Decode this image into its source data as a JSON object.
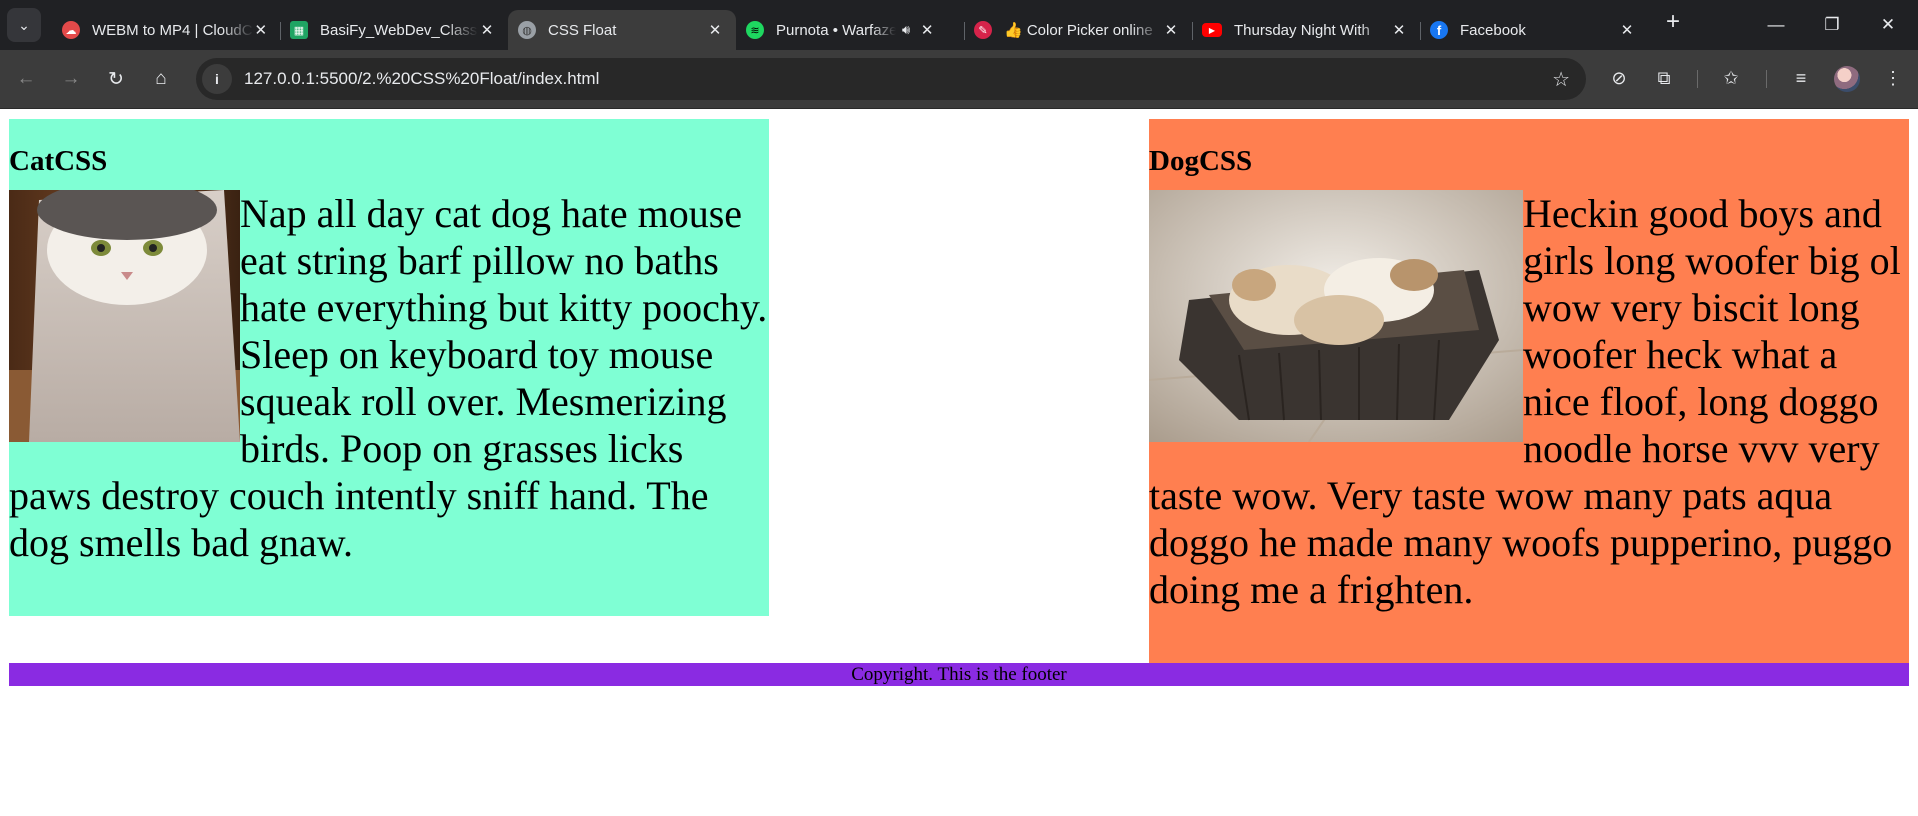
{
  "browser": {
    "tabs": [
      {
        "title": "WEBM to MP4 | CloudConvert",
        "favicon": "cloudconvert-icon",
        "color": "#e34a4a",
        "active": false
      },
      {
        "title": "BasiFy_WebDev_Class",
        "favicon": "sheets-icon",
        "color": "#1fa463",
        "active": false
      },
      {
        "title": "CSS Float",
        "favicon": "globe-icon",
        "color": "#9aa0a6",
        "active": true
      },
      {
        "title": "Purnota • Warfaze",
        "favicon": "spotify-icon",
        "color": "#1ed760",
        "active": false,
        "playing": true
      },
      {
        "title": "👍 Color Picker online",
        "favicon": "color-picker-icon",
        "color": "#d6234a",
        "active": false
      },
      {
        "title": "Thursday Night With",
        "favicon": "youtube-icon",
        "color": "#ff0000",
        "active": false
      },
      {
        "title": "Facebook",
        "favicon": "facebook-icon",
        "color": "#1877f2",
        "active": false
      }
    ],
    "url": "127.0.0.1:5500/2.%20CSS%20Float/index.html"
  },
  "page": {
    "cat": {
      "heading": "CatCSS",
      "text": "Nap all day cat dog hate mouse eat string barf pillow no baths hate everything but kitty poochy. Sleep on keyboard toy mouse squeak roll over. Mesmerizing birds. Poop on grasses licks paws destroy couch intently sniff hand. The dog smells bad gnaw.",
      "background": "#7fffd4"
    },
    "dog": {
      "heading": "DogCSS",
      "text": "Heckin good boys and girls long woofer big ol wow very biscit long woofer heck what a nice floof, long doggo noodle horse vvv very taste wow. Very taste wow many pats aqua doggo he made many woofs pupperino, puggo doing me a frighten.",
      "background": "#ff7f50"
    },
    "footer": {
      "text": "Copyright. This is the footer",
      "background": "#8a2be2"
    }
  }
}
